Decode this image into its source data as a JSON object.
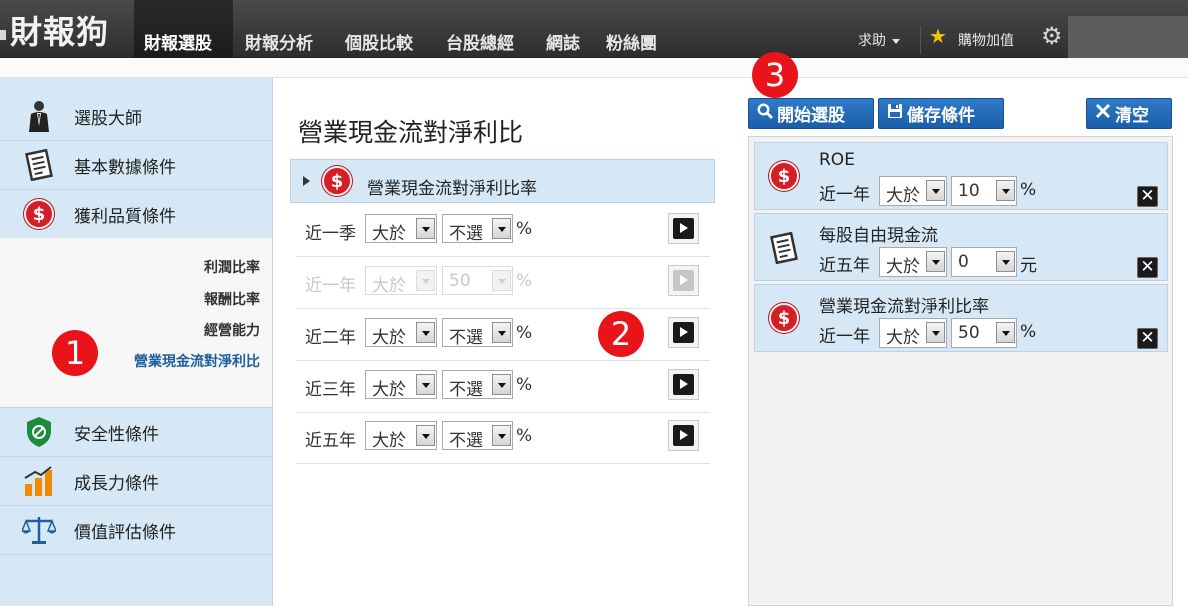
{
  "header": {
    "logo": "財報狗",
    "nav": [
      "財報選股",
      "財報分析",
      "個股比較",
      "台股總經",
      "網誌",
      "粉絲團"
    ],
    "help": "求助",
    "cart": "購物加值"
  },
  "sidebar": {
    "items": [
      {
        "label": "選股大師",
        "icon": "businessman-icon"
      },
      {
        "label": "基本數據條件",
        "icon": "document-icon"
      },
      {
        "label": "獲利品質條件",
        "icon": "dollar-icon"
      },
      {
        "label": "安全性條件",
        "icon": "shield-icon"
      },
      {
        "label": "成長力條件",
        "icon": "growth-bars-icon"
      },
      {
        "label": "價值評估條件",
        "icon": "scales-icon"
      }
    ],
    "submenu": [
      "利潤比率",
      "報酬比率",
      "經營能力",
      "營業現金流對淨利比"
    ],
    "active_submenu": "營業現金流對淨利比"
  },
  "markers": [
    "1",
    "2",
    "3"
  ],
  "main": {
    "title": "營業現金流對淨利比",
    "header_label": "營業現金流對淨利比率",
    "rows": [
      {
        "period": "近一季",
        "op": "大於",
        "value": "不選",
        "unit": "%",
        "enabled": true
      },
      {
        "period": "近一年",
        "op": "大於",
        "value": "50",
        "unit": "%",
        "enabled": false
      },
      {
        "period": "近二年",
        "op": "大於",
        "value": "不選",
        "unit": "%",
        "enabled": true
      },
      {
        "period": "近三年",
        "op": "大於",
        "value": "不選",
        "unit": "%",
        "enabled": true
      },
      {
        "period": "近五年",
        "op": "大於",
        "value": "不選",
        "unit": "%",
        "enabled": true
      }
    ]
  },
  "actions": {
    "start": "開始選股",
    "save": "儲存條件",
    "clear": "清空"
  },
  "selected": [
    {
      "title": "ROE",
      "period": "近一年",
      "op": "大於",
      "value": "10",
      "unit": "%",
      "icon": "dollar-icon"
    },
    {
      "title": "每股自由現金流",
      "period": "近五年",
      "op": "大於",
      "value": "0",
      "unit": "元",
      "icon": "document-icon"
    },
    {
      "title": "營業現金流對淨利比率",
      "period": "近一年",
      "op": "大於",
      "value": "50",
      "unit": "%",
      "icon": "dollar-icon"
    }
  ],
  "colors": {
    "accent_blue": "#1f6cb8",
    "panel_blue": "#d6e8f6",
    "marker_red": "#e8141a",
    "dollar_red": "#d51f26"
  }
}
